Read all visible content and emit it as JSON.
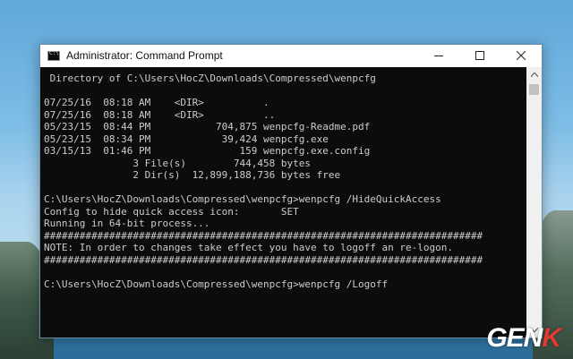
{
  "window": {
    "title": "Administrator: Command Prompt",
    "controls": {
      "minimize": "—",
      "maximize": "☐",
      "close": "✕"
    }
  },
  "console": {
    "lines": [
      " Directory of C:\\Users\\HocZ\\Downloads\\Compressed\\wenpcfg",
      "",
      "07/25/16  08:18 AM    <DIR>          .",
      "07/25/16  08:18 AM    <DIR>          ..",
      "05/23/15  08:44 PM           704,875 wenpcfg-Readme.pdf",
      "05/23/15  08:34 PM            39,424 wenpcfg.exe",
      "03/15/13  01:46 PM               159 wenpcfg.exe.config",
      "               3 File(s)        744,458 bytes",
      "               2 Dir(s)  12,899,188,736 bytes free",
      "",
      "C:\\Users\\HocZ\\Downloads\\Compressed\\wenpcfg>wenpcfg /HideQuickAccess",
      "Config to hide quick access icon:       SET",
      "Running in 64-bit process...",
      "##########################################################################",
      "NOTE: In order to changes take effect you have to logoff an re-logon.",
      "##########################################################################",
      "",
      "C:\\Users\\HocZ\\Downloads\\Compressed\\wenpcfg>wenpcfg /Logoff"
    ]
  },
  "watermark": {
    "main": "GEN",
    "accent": "K"
  }
}
